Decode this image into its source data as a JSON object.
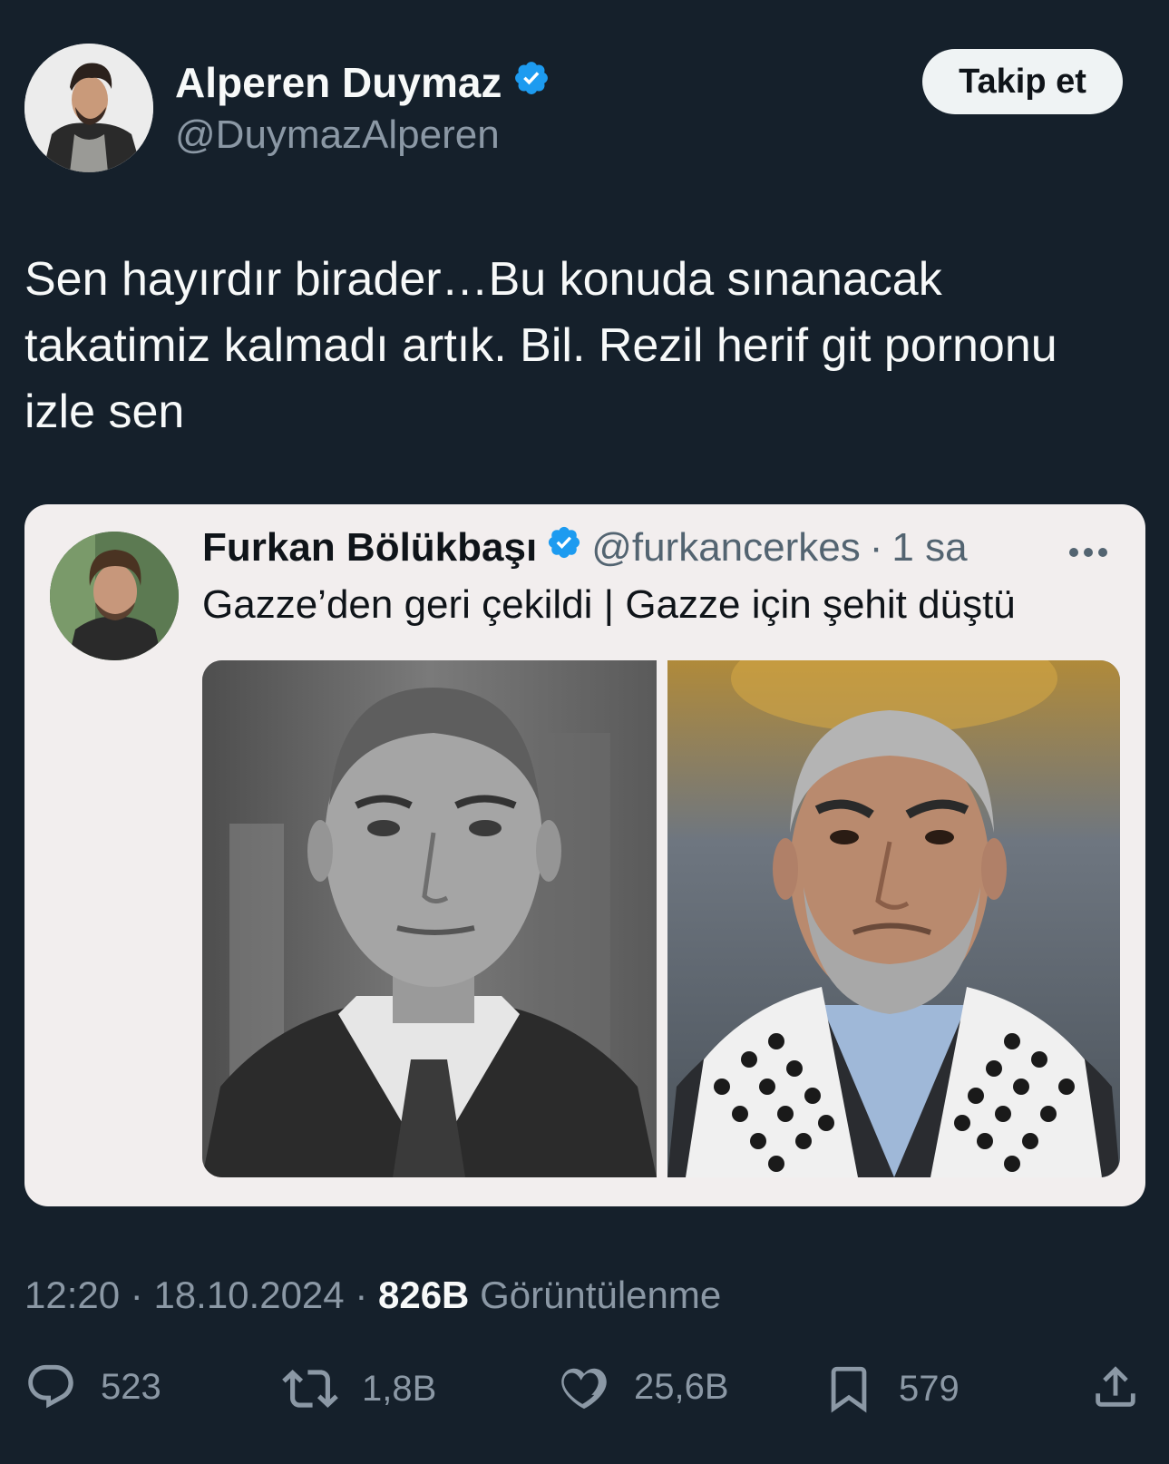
{
  "author": {
    "display_name": "Alperen Duymaz",
    "handle": "@DuymazAlperen",
    "verified": true,
    "avatar_icon": "profile-photo"
  },
  "follow_label": "Takip et",
  "tweet_text": "Sen hayırdır birader…Bu konuda sınanacak takatimiz kalmadı artık. Bil. Rezil herif git pornonu izle sen",
  "quote": {
    "display_name": "Furkan Bölükbaşı",
    "handle": "@furkancerkes",
    "separator": "·",
    "time": "1 sa",
    "text": "Gazze’den geri çekildi | Gazze için şehit düştü",
    "images": [
      "black-and-white-portrait-photo",
      "color-portrait-photo"
    ]
  },
  "meta": {
    "time": "12:20",
    "date": "18.10.2024",
    "views": "826B",
    "views_label": "Görüntülenme"
  },
  "stats": {
    "replies": "523",
    "retweets": "1,8B",
    "likes": "25,6B",
    "bookmarks": "579"
  },
  "colors": {
    "background": "#15202b",
    "verified": "#1d9bf0",
    "secondary_text": "#8b98a5",
    "quote_background": "#f2eeee"
  }
}
